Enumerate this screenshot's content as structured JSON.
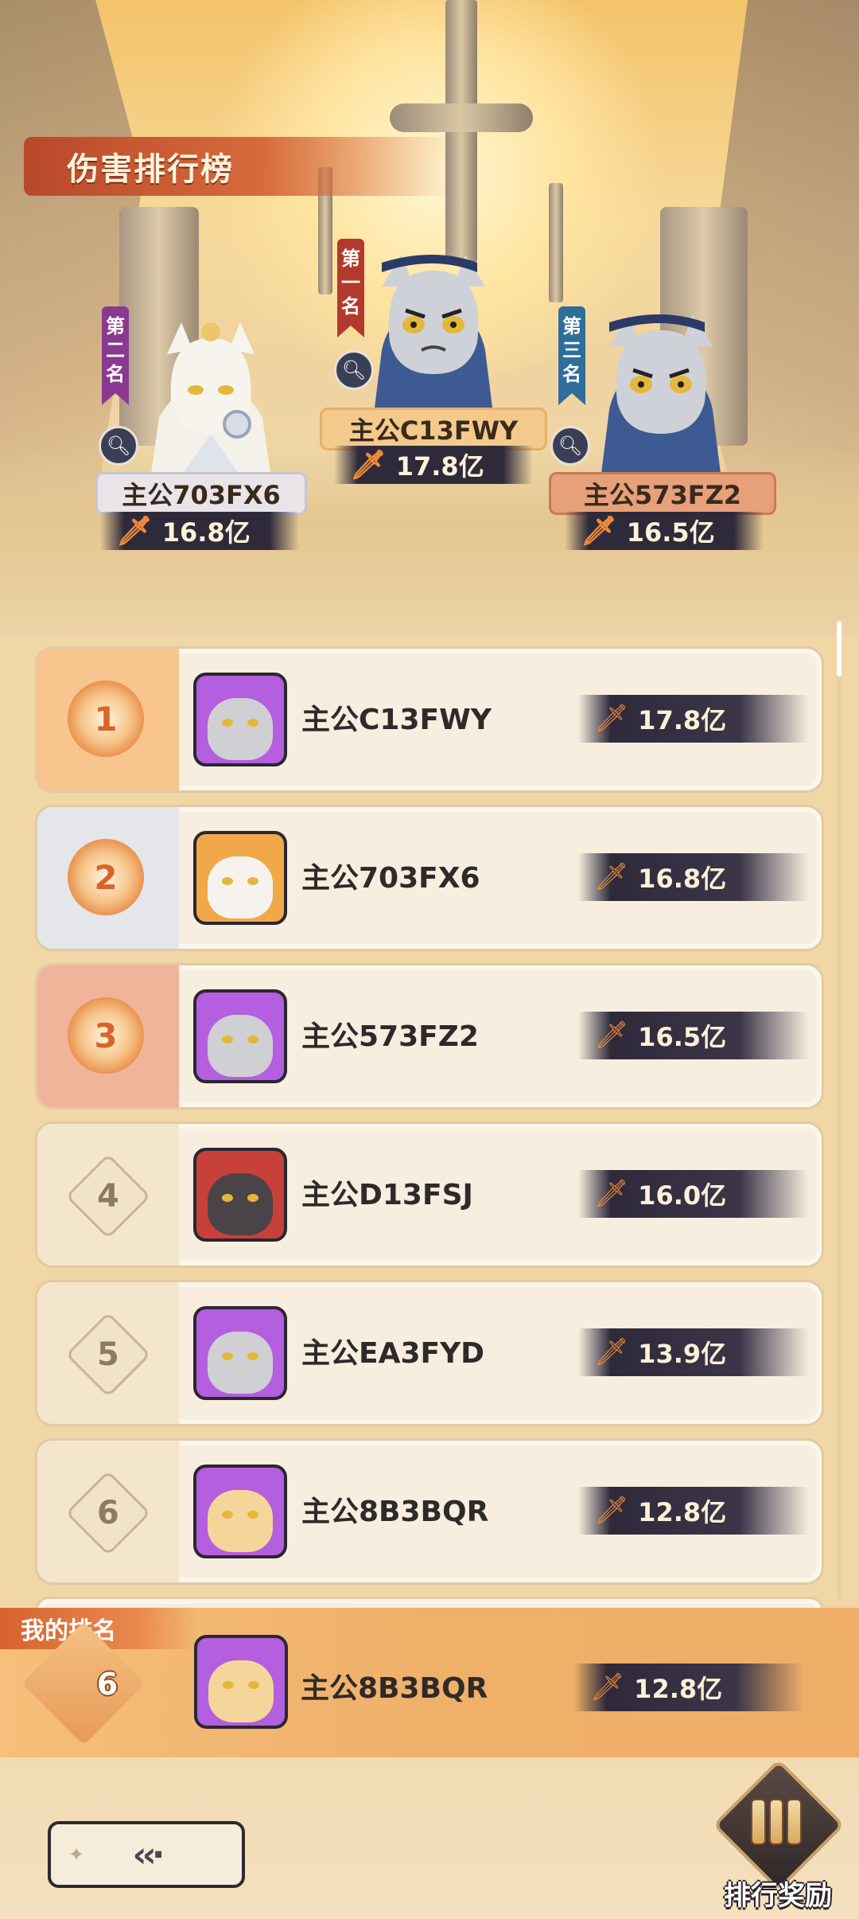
{
  "title": "伤害排行榜",
  "podium": [
    {
      "rank_label": "第一名",
      "name": "主公C13FWY",
      "damage": "17.8亿",
      "tag_color": "#b23a2c",
      "plate_color": "#f3c98c"
    },
    {
      "rank_label": "第二名",
      "name": "主公703FX6",
      "damage": "16.8亿",
      "tag_color": "#8a3a8e",
      "plate_color": "#e8e4e8"
    },
    {
      "rank_label": "第三名",
      "name": "主公573FZ2",
      "damage": "16.5亿",
      "tag_color": "#2f6e9a",
      "plate_color": "#e6a07a"
    }
  ],
  "rows": [
    {
      "rank": "1",
      "name": "主公C13FWY",
      "damage": "17.8亿",
      "avatar_bg": "#b45ee0",
      "avatar_face": "#cfcfd4"
    },
    {
      "rank": "2",
      "name": "主公703FX6",
      "damage": "16.8亿",
      "avatar_bg": "#f0a848",
      "avatar_face": "#f6f3ef"
    },
    {
      "rank": "3",
      "name": "主公573FZ2",
      "damage": "16.5亿",
      "avatar_bg": "#b45ee0",
      "avatar_face": "#cfcfd4"
    },
    {
      "rank": "4",
      "name": "主公D13FSJ",
      "damage": "16.0亿",
      "avatar_bg": "#c8403a",
      "avatar_face": "#4a4448"
    },
    {
      "rank": "5",
      "name": "主公EA3FYD",
      "damage": "13.9亿",
      "avatar_bg": "#b45ee0",
      "avatar_face": "#cfcfd4"
    },
    {
      "rank": "6",
      "name": "主公8B3BQR",
      "damage": "12.8亿",
      "avatar_bg": "#b45ee0",
      "avatar_face": "#f4d59a"
    }
  ],
  "my_rank": {
    "label": "我的排名",
    "rank": "6",
    "name": "主公8B3BQR",
    "damage": "12.8亿",
    "avatar_bg": "#b45ee0",
    "avatar_face": "#f4d59a"
  },
  "reward_button": "排行奖励",
  "colors": {
    "accent": "#d66a3c",
    "row_rank1": "#f7c58d",
    "row_rank2": "#e4e6ea",
    "row_rank3": "#efb49a"
  },
  "icons": {
    "search": "magnifier-icon",
    "sword": "sword-icon",
    "back": "back-arrow-icon",
    "reward": "scroll-reward-icon"
  }
}
